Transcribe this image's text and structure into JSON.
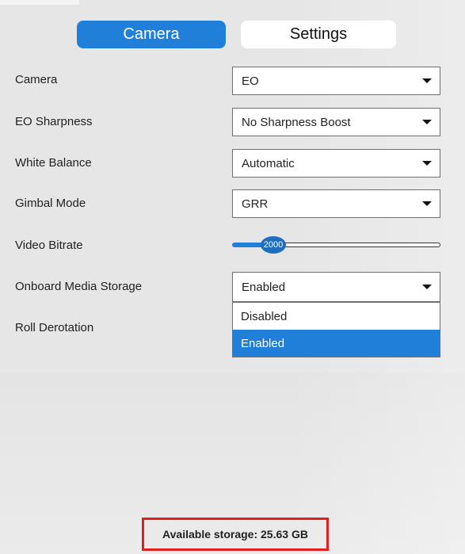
{
  "tabs": {
    "camera": "Camera",
    "settings": "Settings"
  },
  "rows": [
    {
      "label": "Camera",
      "value": "EO"
    },
    {
      "label": "EO Sharpness",
      "value": "No Sharpness Boost"
    },
    {
      "label": "White Balance",
      "value": "Automatic"
    },
    {
      "label": "Gimbal Mode",
      "value": "GRR"
    },
    {
      "label": "Video Bitrate",
      "slider_value": "2000"
    },
    {
      "label": "Onboard Media Storage",
      "value": "Enabled"
    },
    {
      "label": "Roll Derotation"
    }
  ],
  "dropdown_options": [
    "Disabled",
    "Enabled"
  ],
  "storage": "Available storage: 25.63 GB",
  "colors": {
    "accent": "#1f7fd9",
    "highlight_border": "#e0201f"
  }
}
